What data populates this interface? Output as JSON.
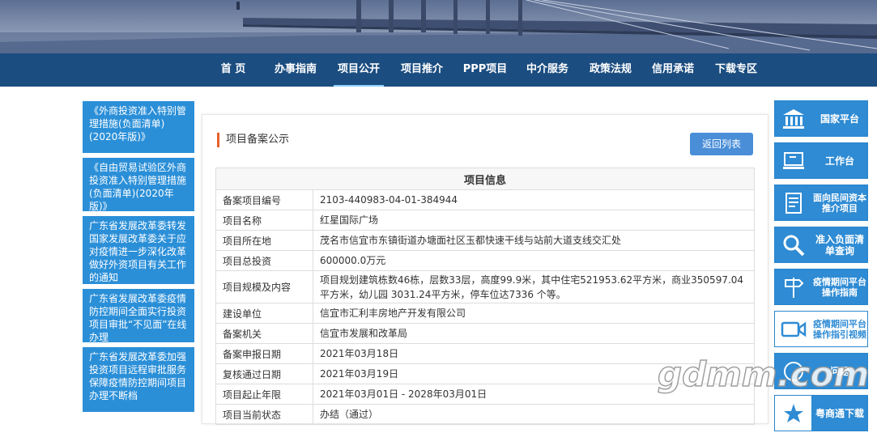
{
  "nav": {
    "items": [
      "首 页",
      "办事指南",
      "项目公开",
      "项目推介",
      "PPP项目",
      "中介服务",
      "政策法规",
      "信用承诺",
      "下载专区"
    ],
    "active": "项目公开"
  },
  "left_news": [
    "《外商投资准入特别管理措施(负面清单)(2020年版)》",
    "《自由贸易试验区外商投资准入特别管理措施(负面清单)(2020年版)》",
    "广东省发展改革委转发国家发展改革委关于应对疫情进一步深化改革做好外资项目有关工作的通知",
    "广东省发展改革委疫情防控期间全面实行投资项目审批“不见面”在线办理",
    "广东省发展改革委加强投资项目远程审批服务保障疫情防控期间项目办理不断档"
  ],
  "main": {
    "section_title": "项目备案公示",
    "back_button": "返回列表",
    "table_title": "项目信息",
    "rows": [
      {
        "label": "备案项目编号",
        "value": "2103-440983-04-01-384944"
      },
      {
        "label": "项目名称",
        "value": "红星国际广场"
      },
      {
        "label": "项目所在地",
        "value": "茂名市信宜市东镇街道办塘面社区玉都快速干线与站前大道支线交汇处"
      },
      {
        "label": "项目总投资",
        "value": "600000.0万元"
      },
      {
        "label": "项目规模及内容",
        "value": "项目规划建筑栋数46栋，层数33层，高度99.9米，其中住宅521953.62平方米，商业350597.04平方米，幼儿园 3031.24平方米，停车位达7336 个等。"
      },
      {
        "label": "建设单位",
        "value": "信宜市汇利丰房地产开发有限公司"
      },
      {
        "label": "备案机关",
        "value": "信宜市发展和改革局"
      },
      {
        "label": "备案申报日期",
        "value": "2021年03月18日"
      },
      {
        "label": "复核通过日期",
        "value": "2021年03月19日"
      },
      {
        "label": "项目起止年限",
        "value": "2021年03月01日 - 2028年03月01日"
      },
      {
        "label": "项目当前状态",
        "value": "办结（通过）"
      }
    ]
  },
  "right_buttons": [
    {
      "label": "国家平台",
      "icon": "institution-icon"
    },
    {
      "label": "工作台",
      "icon": "workstation-icon"
    },
    {
      "label": "面向民间资本推介项目",
      "icon": "document-list-icon"
    },
    {
      "label": "准入负面清单查询",
      "icon": "search-icon"
    },
    {
      "label": "疫情期间平台操作指南",
      "icon": "signpost-icon"
    },
    {
      "label": "疫情期间平台操作指引视频",
      "icon": "video-camera-icon"
    },
    {
      "label": "问题",
      "icon": "help-icon"
    },
    {
      "label": "粤商通下载",
      "icon": "app-logo-icon"
    }
  ],
  "watermark": "gdmm.com",
  "colors": {
    "nav_bg": "#1b4d80",
    "news_bg": "#2b8fd8",
    "button_blue": "#2e8bd4",
    "accent_orange": "#e8612b",
    "back_button": "#4a8ed8"
  }
}
